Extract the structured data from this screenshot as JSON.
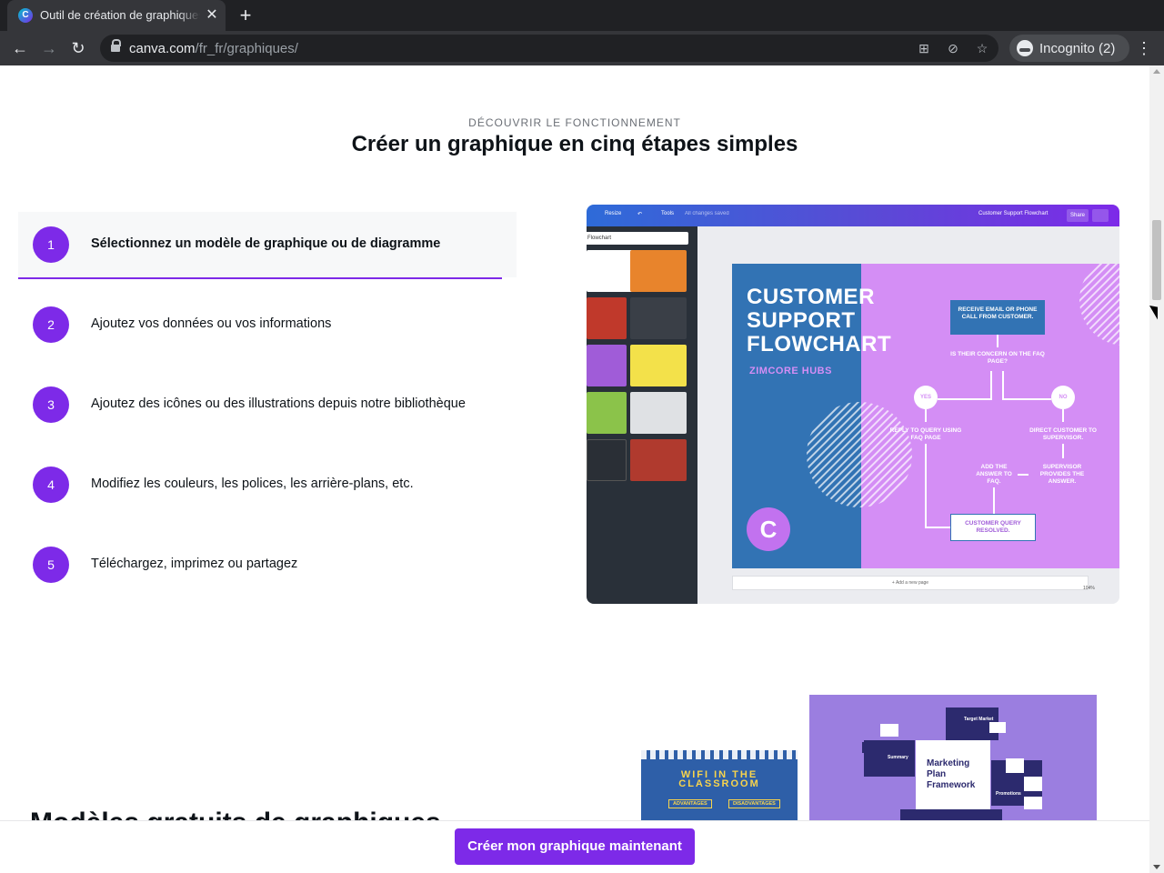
{
  "browser": {
    "tab_title": "Outil de création de graphiques",
    "favicon_letter": "C",
    "close_glyph": "✕",
    "newtab_glyph": "+",
    "url_host": "canva.com",
    "url_path": "/fr_fr/graphiques/",
    "profile_label": "Incognito (2)",
    "icons": [
      "back-icon",
      "forward-icon",
      "reload-icon",
      "lock-icon",
      "translate-icon",
      "eye-slash-icon",
      "star-icon",
      "incognito-icon",
      "menu-dots-icon"
    ]
  },
  "section": {
    "eyebrow": "DÉCOUVRIR LE FONCTIONNEMENT",
    "heading": "Créer un graphique en cinq étapes simples"
  },
  "steps": [
    {
      "num": "1",
      "label": "Sélectionnez un modèle de graphique ou de diagramme",
      "active": true
    },
    {
      "num": "2",
      "label": "Ajoutez vos données ou vos informations",
      "active": false
    },
    {
      "num": "3",
      "label": "Ajoutez des icônes ou des illustrations depuis notre bibliothèque",
      "active": false
    },
    {
      "num": "4",
      "label": "Modifiez les couleurs, les polices, les arrière-plans, etc.",
      "active": false
    },
    {
      "num": "5",
      "label": "Téléchargez, imprimez ou partagez",
      "active": false
    }
  ],
  "preview": {
    "toolbar": {
      "resize": "Resize",
      "tools": "Tools",
      "saved": "All changes saved",
      "doc_title": "Customer Support Flowchart",
      "share": "Share"
    },
    "search": "Flowchart",
    "title": "CUSTOMER SUPPORT FLOWCHART",
    "subtitle": "ZIMCORE HUBS",
    "logo_letter": "C",
    "box1": "RECEIVE EMAIL OR PHONE CALL FROM CUSTOMER.",
    "question": "IS THEIR CONCERN ON THE FAQ PAGE?",
    "yes": "YES",
    "no": "NO",
    "reply": "REPLY TO QUERY USING FAQ PAGE",
    "direct": "DIRECT CUSTOMER TO SUPERVISOR.",
    "add_answer": "ADD THE ANSWER TO FAQ.",
    "supervisor": "SUPERVISOR PROVIDES THE ANSWER.",
    "resolved": "CUSTOMER QUERY RESOLVED.",
    "add_page": "+ Add a new page",
    "zoom": "104%",
    "thumb_colors": [
      "#ffffff",
      "#e8842c",
      "#c0392b",
      "#3a3f47",
      "#a05cd8",
      "#f3e14a",
      "#8bc34a",
      "#2a2f36",
      "#b03a2e",
      "#c0392b"
    ]
  },
  "lower": {
    "title": "Modèles gratuits de graphiques",
    "wifi_title": "WIFI IN THE CLASSROOM",
    "wifi_adv": "ADVANTAGES",
    "wifi_dis": "DISADVANTAGES",
    "mkt_title": "Marketing Plan Framework",
    "mkt_labels": [
      "Target Market",
      "Summary",
      "Promotions"
    ]
  },
  "cta": {
    "label": "Créer mon graphique maintenant"
  },
  "colors": {
    "accent": "#7d2ae8",
    "chrome_dark": "#202124",
    "chrome": "#35363a"
  }
}
